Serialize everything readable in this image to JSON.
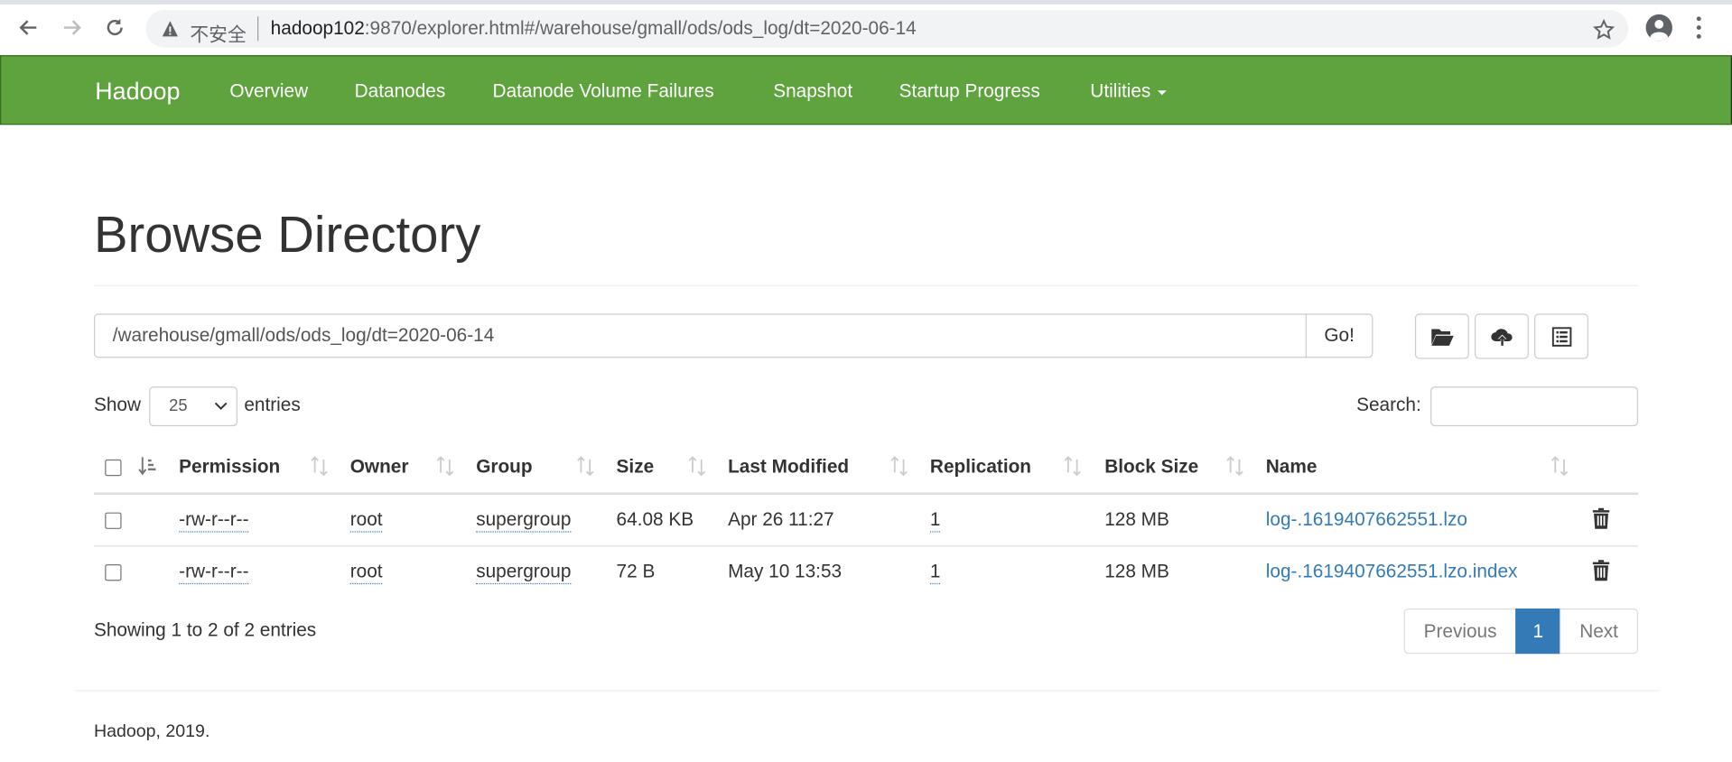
{
  "browser": {
    "security_label": "不安全",
    "url_host": "hadoop102",
    "url_rest": ":9870/explorer.html#/warehouse/gmall/ods/ods_log/dt=2020-06-14"
  },
  "navbar": {
    "brand": "Hadoop",
    "items": [
      "Overview",
      "Datanodes",
      "Datanode Volume Failures",
      "Snapshot",
      "Startup Progress",
      "Utilities"
    ]
  },
  "page": {
    "title": "Browse Directory",
    "path_value": "/warehouse/gmall/ods/ods_log/dt=2020-06-14",
    "go_label": "Go!"
  },
  "controls": {
    "show_label": "Show",
    "page_length": "25",
    "entries_label": "entries",
    "search_label": "Search:"
  },
  "table": {
    "headers": [
      "Permission",
      "Owner",
      "Group",
      "Size",
      "Last Modified",
      "Replication",
      "Block Size",
      "Name"
    ],
    "rows": [
      {
        "permission": "-rw-r--r--",
        "owner": "root",
        "group": "supergroup",
        "size": "64.08 KB",
        "modified": "Apr 26 11:27",
        "replication": "1",
        "block_size": "128 MB",
        "name": "log-.1619407662551.lzo"
      },
      {
        "permission": "-rw-r--r--",
        "owner": "root",
        "group": "supergroup",
        "size": "72 B",
        "modified": "May 10 13:53",
        "replication": "1",
        "block_size": "128 MB",
        "name": "log-.1619407662551.lzo.index"
      }
    ]
  },
  "pagination": {
    "info": "Showing 1 to 2 of 2 entries",
    "previous": "Previous",
    "current": "1",
    "next": "Next"
  },
  "footer": {
    "text": "Hadoop, 2019."
  },
  "colors": {
    "navbar_green": "#5fa33e",
    "link_blue": "#337ab7"
  }
}
